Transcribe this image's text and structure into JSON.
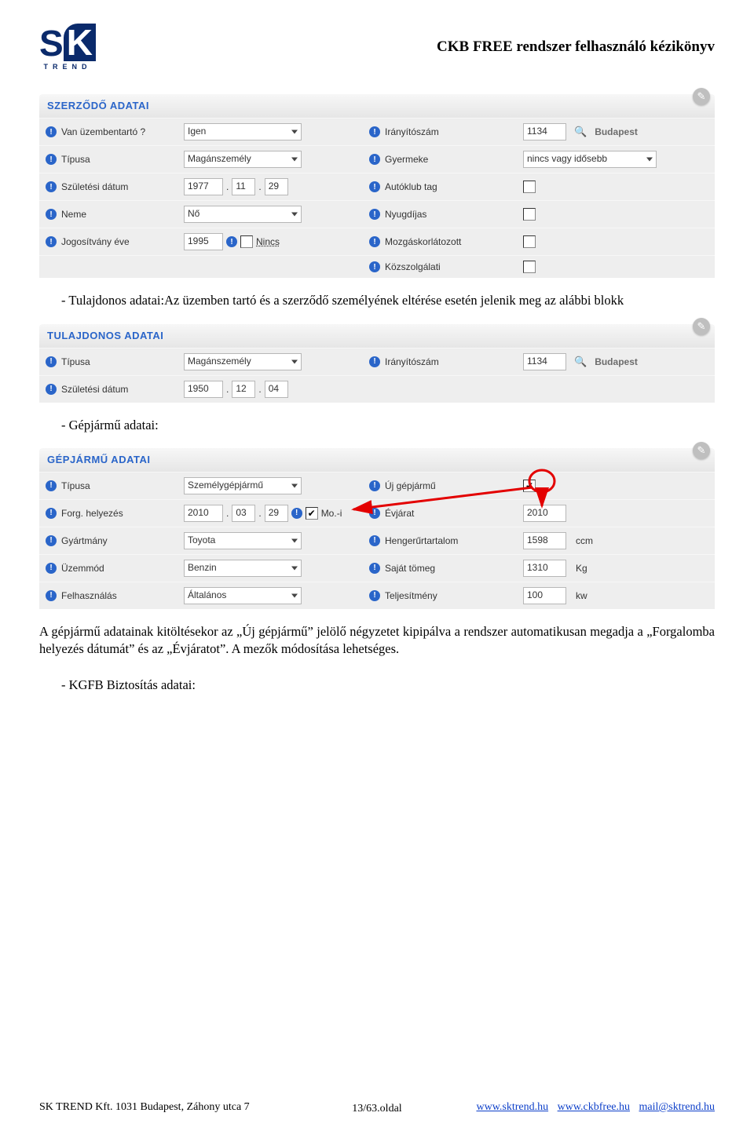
{
  "doc": {
    "title": "CKB FREE rendszer felhasználó kézikönyv",
    "brand_letters": "K",
    "brand_s": "S",
    "brand_sub": "TREND"
  },
  "sections": {
    "szerzodo": "SZERZŐDŐ ADATAI",
    "tulajdonos": "TULAJDONOS ADATAI",
    "gepjarmu": "GÉPJÁRMŰ ADATAI"
  },
  "labels": {
    "van_uzembentarto": "Van üzembentartó ?",
    "tipusa": "Típusa",
    "szuletesi_datum": "Születési dátum",
    "neme": "Neme",
    "jogositvany_eve": "Jogosítvány éve",
    "iranyitoszam": "Irányítószám",
    "gyermeke": "Gyermeke",
    "autoklub_tag": "Autóklub tag",
    "nyugdijas": "Nyugdíjas",
    "mozgaskorlatozott": "Mozgáskorlátozott",
    "kozszolgalati": "Közszolgálati",
    "nincs": "Nincs",
    "forg_helyezes": "Forg. helyezés",
    "gyartmany": "Gyártmány",
    "uzemmod": "Üzemmód",
    "felhasznalas": "Felhasználás",
    "uj_gepjarmu": "Új gépjármű",
    "evjarat": "Évjárat",
    "hengerurtartalom": "Hengerűrtartalom",
    "sajat_tomeg": "Saját tömeg",
    "teljesitmeny": "Teljesítmény",
    "mo_i": "Mo.-i"
  },
  "values": {
    "igen": "Igen",
    "maganszemely": "Magánszemély",
    "dob_1977": "1977",
    "dob_11": "11",
    "dob_29": "29",
    "no": "Nő",
    "jog_ev": "1995",
    "irsz": "1134",
    "budapest": "Budapest",
    "gyermeke": "nincs vagy idősebb",
    "tul_dob_y": "1950",
    "tul_dob_m": "12",
    "tul_dob_d": "04",
    "szemelygepjarmu": "Személygépjármű",
    "fh_y": "2010",
    "fh_m": "03",
    "fh_d": "29",
    "toyota": "Toyota",
    "benzin": "Benzin",
    "altalanos": "Általános",
    "evjarat": "2010",
    "henger": "1598",
    "tomeg": "1310",
    "telj": "100",
    "ccm": "ccm",
    "kg": "Kg",
    "kw": "kw"
  },
  "body": {
    "p1": "-   Tulajdonos adatai:Az üzemben tartó és a szerződő személyének eltérése esetén jelenik meg az alábbi blokk",
    "p2": "-   Gépjármű adatai:",
    "p3": "A gépjármű adatainak kitöltésekor az „Új gépjármű” jelölő négyzetet kipipálva a rendszer automatikusan megadja a „Forgalomba helyezés dátumát” és az „Évjáratot”. A mezők módosítása lehetséges.",
    "p4": "-   KGFB Biztosítás adatai:"
  },
  "footer": {
    "company": "SK TREND Kft. 1031 Budapest, Záhony utca 7",
    "page": "13/63.oldal",
    "link1": "www.sktrend.hu",
    "link2": "www.ckbfree.hu",
    "link3": "mail@sktrend.hu"
  }
}
